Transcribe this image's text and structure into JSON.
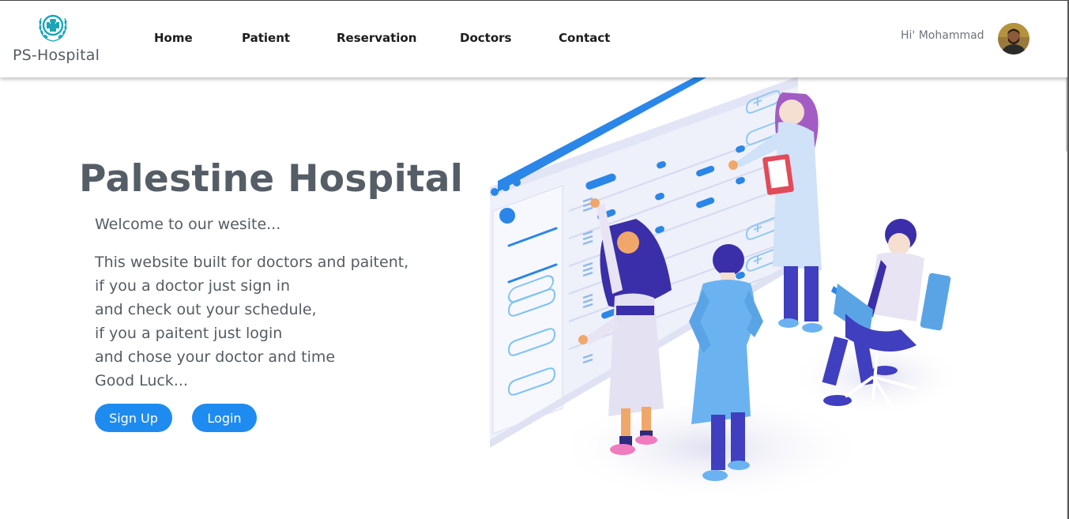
{
  "header": {
    "brand_name": "PS-Hospital",
    "nav": [
      "Home",
      "Patient",
      "Reservation",
      "Doctors",
      "Contact"
    ],
    "greeting": "Hi' Mohammad"
  },
  "hero": {
    "title": "Palestine Hospital",
    "welcome": "Welcome to our wesite...",
    "lines": [
      "This website built for doctors and paitent,",
      "if you a doctor just sign in",
      "and check out your schedule,",
      "if you a paitent just login",
      "and chose your doctor and time",
      "Good Luck..."
    ],
    "signup_label": "Sign Up",
    "login_label": "Login"
  },
  "colors": {
    "accent": "#1e8bf0",
    "logo": "#1aa6b7",
    "text": "#555c62"
  },
  "icons": {
    "logo": "medical-cross-wreath-icon",
    "avatar": "user-avatar-photo"
  }
}
